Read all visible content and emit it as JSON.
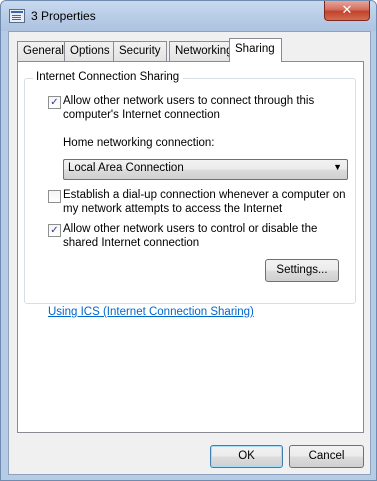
{
  "window": {
    "title": "3 Properties",
    "close_glyph": "✕"
  },
  "tabs": [
    {
      "label": "General"
    },
    {
      "label": "Options"
    },
    {
      "label": "Security"
    },
    {
      "label": "Networking"
    },
    {
      "label": "Sharing",
      "active": true
    }
  ],
  "sharing": {
    "group_label": "Internet Connection Sharing",
    "allow_connect": {
      "checked": true,
      "line1": "Allow other network users to connect through this",
      "line2": "computer's Internet connection"
    },
    "home_label": "Home networking connection:",
    "home_value": "Local Area Connection",
    "dialup": {
      "checked": false,
      "line1": "Establish a dial-up connection whenever a computer on",
      "line2": "my network attempts to access the Internet"
    },
    "allow_control": {
      "checked": true,
      "line1": "Allow other network users to control or disable the",
      "line2": "shared Internet connection"
    },
    "ics_link": "Using ICS (Internet Connection Sharing)",
    "settings_button": "Settings..."
  },
  "buttons": {
    "ok": "OK",
    "cancel": "Cancel"
  },
  "icons": {
    "checkmark": "✓",
    "dropdown": "▼"
  }
}
